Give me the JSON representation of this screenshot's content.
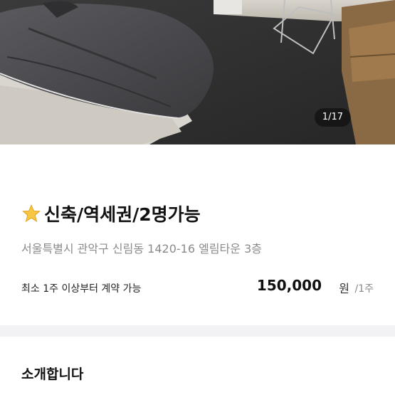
{
  "gallery": {
    "counter": "1/17",
    "current": 1,
    "total": 17
  },
  "listing": {
    "title_icon": "star-icon",
    "title": "신축/역세권/2명가능",
    "address": "서울특별시 관악구 신림동 1420-16 엘림타운 3층",
    "contract_note": "최소 1주 이상부터 계약 가능",
    "price": "150,000",
    "price_unit": "원",
    "period": "/1주"
  },
  "section": {
    "intro_title": "소개합니다"
  }
}
